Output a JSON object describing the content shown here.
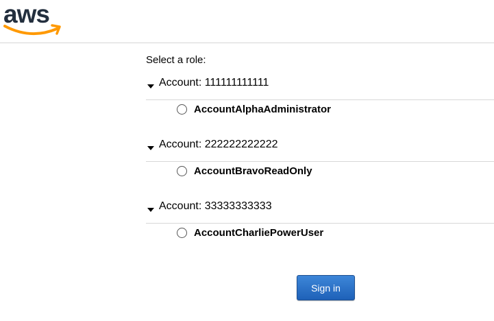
{
  "header": {
    "logo_text": "aws"
  },
  "form": {
    "select_label": "Select a role:",
    "accounts": [
      {
        "title": "Account: 111111111111",
        "role": "AccountAlphaAdministrator"
      },
      {
        "title": "Account: 222222222222",
        "role": "AccountBravoReadOnly"
      },
      {
        "title": "Account: 33333333333",
        "role": "AccountCharliePowerUser"
      }
    ],
    "signin_label": "Sign in"
  },
  "colors": {
    "logo_text": "#232f3e",
    "logo_smile": "#ff9900",
    "button": "#2a6fc9"
  }
}
